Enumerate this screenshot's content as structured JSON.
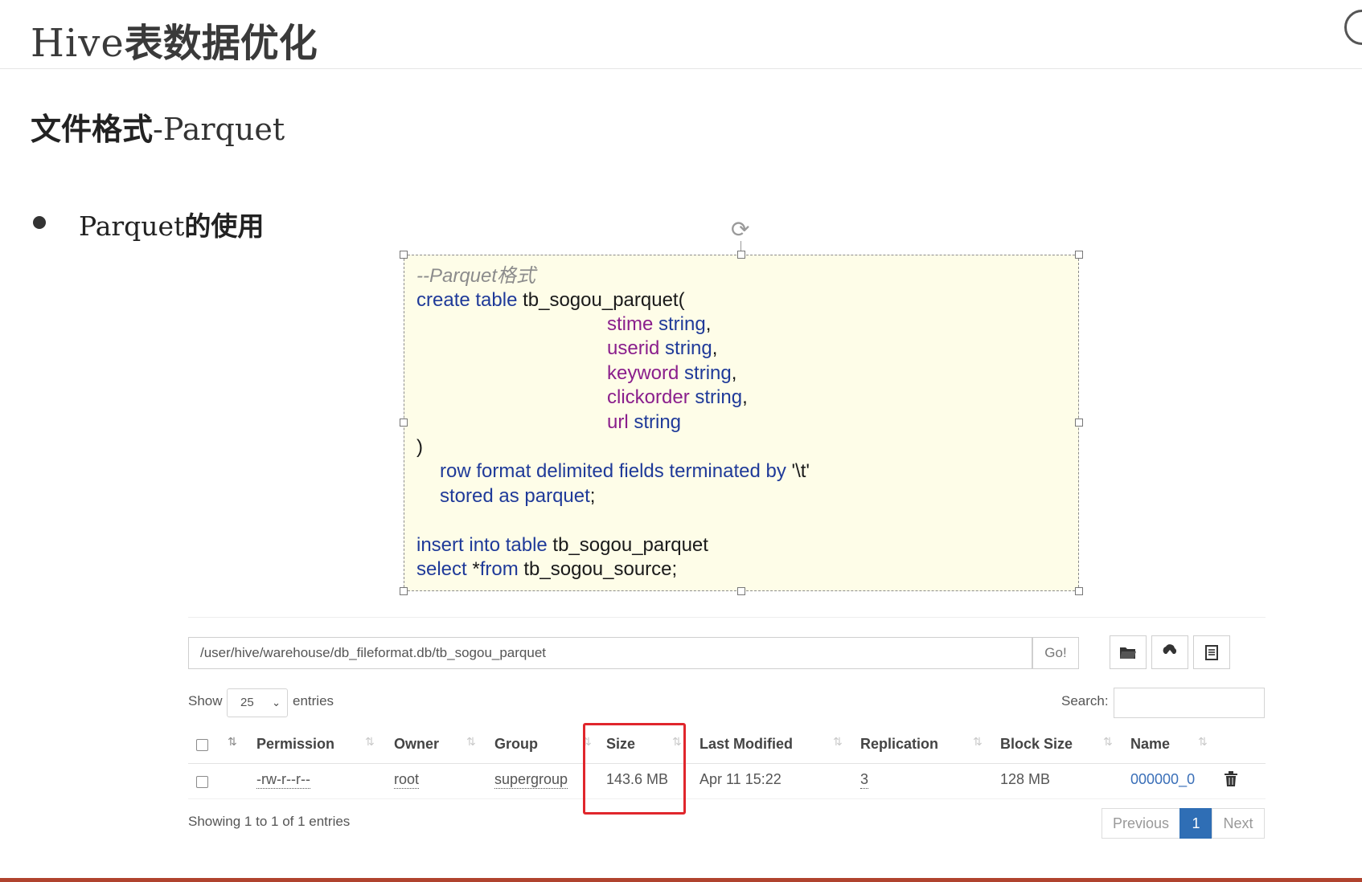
{
  "slide": {
    "title_latin": "Hive",
    "title_cn": "表数据优化",
    "subtitle_cn": "文件格式",
    "subtitle_en": "-Parquet",
    "bullet_en": "Parquet",
    "bullet_cn": "的使用"
  },
  "code": {
    "comment": "--Parquet格式",
    "l1_kw": "create table",
    "l1_rest": " tb_sogou_parquet(",
    "f1_name": "stime",
    "f1_type": " string",
    "f1_sep": ",",
    "f2_name": "userid",
    "f2_type": " string",
    "f2_sep": ",",
    "f3_name": "keyword",
    "f3_type": " string",
    "f3_sep": ",",
    "f4_name": "clickorder",
    "f4_type": " string",
    "f4_sep": ",",
    "f5_name": "url",
    "f5_type": " string",
    "close_paren": ")",
    "row_kw": "row format delimited fields terminated by",
    "row_rest": " '\\t'",
    "stored_kw": "stored as parquet",
    "stored_rest": ";",
    "insert_kw": "insert into table",
    "insert_rest": " tb_sogou_parquet",
    "select_kw": "select",
    "select_mid": "  *",
    "from_kw": "from",
    "from_rest": " tb_sogou_source;"
  },
  "browser": {
    "path": "/user/hive/warehouse/db_fileformat.db/tb_sogou_parquet",
    "go_label": "Go!",
    "toolbar_icons": [
      "folder-icon",
      "upload-icon",
      "clipboard-icon"
    ],
    "show_label": "Show",
    "entries_value": "25",
    "entries_label": "entries",
    "search_label": "Search:",
    "columns": [
      "Permission",
      "Owner",
      "Group",
      "Size",
      "Last Modified",
      "Replication",
      "Block Size",
      "Name"
    ],
    "row": {
      "permission": "-rw-r--r--",
      "owner": "root",
      "group": "supergroup",
      "size": "143.6 MB",
      "last_modified": "Apr 11 15:22",
      "replication": "3",
      "block_size": "128 MB",
      "name": "000000_0"
    },
    "info": "Showing 1 to 1 of 1 entries",
    "pagination": {
      "previous": "Previous",
      "current": "1",
      "next": "Next"
    }
  },
  "colors": {
    "keyword": "#1f3a99",
    "field": "#8a1e8c",
    "highlight": "#e0262c",
    "page_active": "#2f6eb5"
  }
}
